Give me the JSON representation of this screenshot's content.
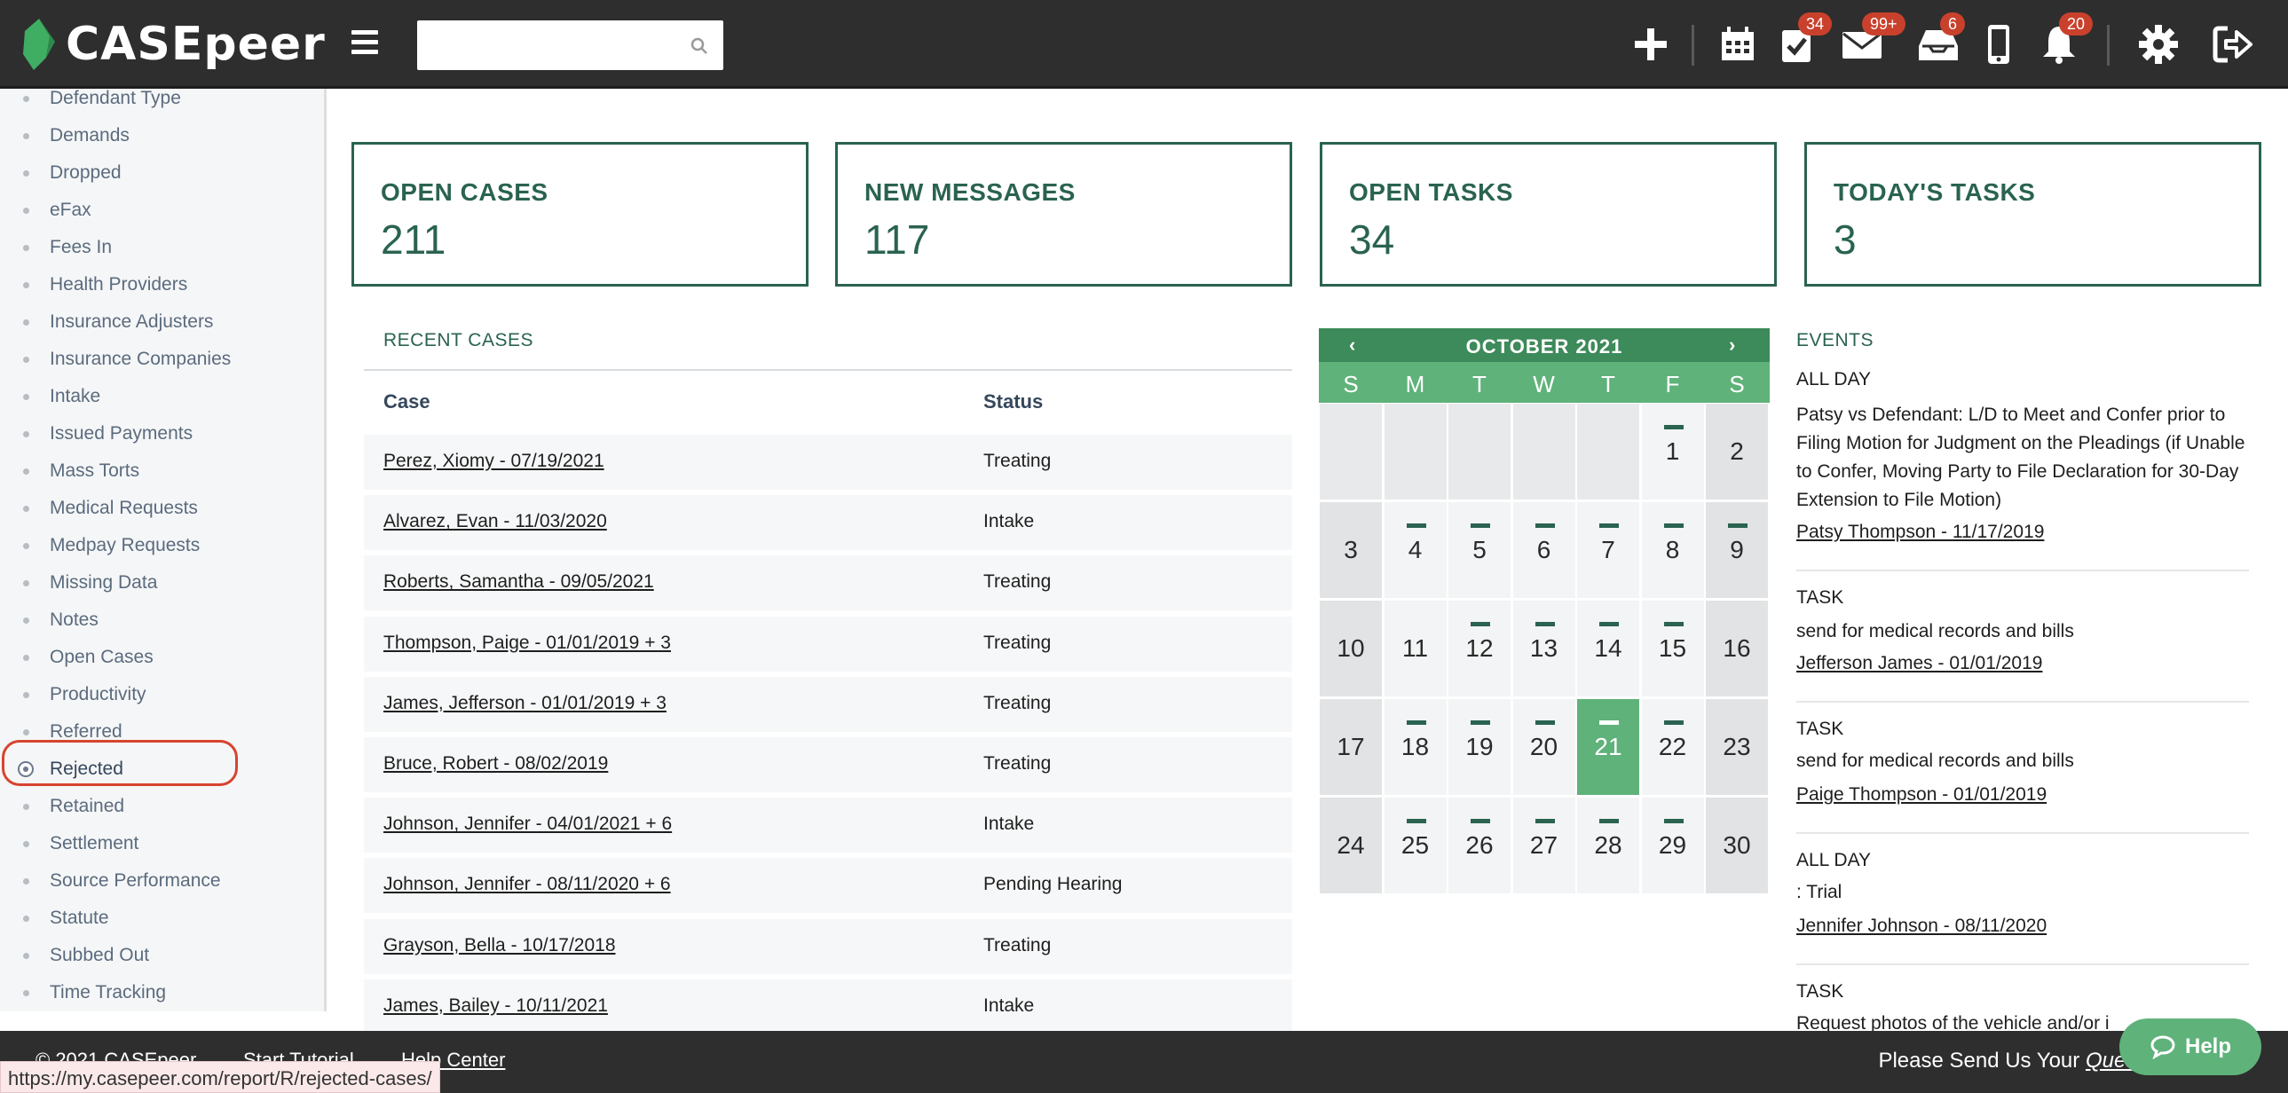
{
  "app": {
    "logo_text": "CASEpeer"
  },
  "search": {
    "placeholder": ""
  },
  "topbar": {
    "badges": {
      "tasks": "34",
      "messages": "99+",
      "inbox": "6",
      "notifications": "20"
    }
  },
  "sidebar": {
    "items": [
      "Defendant Type",
      "Demands",
      "Dropped",
      "eFax",
      "Fees In",
      "Health Providers",
      "Insurance Adjusters",
      "Insurance Companies",
      "Intake",
      "Issued Payments",
      "Mass Torts",
      "Medical Requests",
      "Medpay Requests",
      "Missing Data",
      "Notes",
      "Open Cases",
      "Productivity",
      "Referred",
      "Rejected",
      "Retained",
      "Settlement",
      "Source Performance",
      "Statute",
      "Subbed Out",
      "Time Tracking"
    ],
    "active": "Rejected"
  },
  "stats": [
    {
      "title": "OPEN CASES",
      "value": "211"
    },
    {
      "title": "NEW MESSAGES",
      "value": "117"
    },
    {
      "title": "OPEN TASKS",
      "value": "34"
    },
    {
      "title": "TODAY'S TASKS",
      "value": "3"
    }
  ],
  "recent_cases": {
    "title": "RECENT CASES",
    "col_case": "Case",
    "col_status": "Status",
    "rows": [
      {
        "case": "Perez, Xiomy - 07/19/2021",
        "status": "Treating"
      },
      {
        "case": "Alvarez, Evan - 11/03/2020",
        "status": "Intake"
      },
      {
        "case": "Roberts, Samantha - 09/05/2021",
        "status": "Treating"
      },
      {
        "case": "Thompson, Paige - 01/01/2019 + 3",
        "status": "Treating"
      },
      {
        "case": "James, Jefferson - 01/01/2019 + 3",
        "status": "Treating"
      },
      {
        "case": "Bruce, Robert - 08/02/2019",
        "status": "Treating"
      },
      {
        "case": "Johnson, Jennifer - 04/01/2021 + 6",
        "status": "Intake"
      },
      {
        "case": "Johnson, Jennifer - 08/11/2020 + 6",
        "status": "Pending Hearing"
      },
      {
        "case": "Grayson, Bella - 10/17/2018",
        "status": "Treating"
      },
      {
        "case": "James, Bailey - 10/11/2021",
        "status": "Intake"
      }
    ]
  },
  "calendar": {
    "prev": "‹",
    "next": "›",
    "month": "OCTOBER 2021",
    "dow": [
      "S",
      "M",
      "T",
      "W",
      "T",
      "F",
      "S"
    ],
    "first_weekday": 5,
    "days": 30,
    "today": 21,
    "event_days": [
      1,
      4,
      5,
      6,
      7,
      8,
      9,
      12,
      13,
      14,
      15,
      18,
      19,
      20,
      21,
      22,
      25,
      26,
      27,
      28,
      29
    ]
  },
  "events": {
    "title": "EVENTS",
    "items": [
      {
        "type": "ALL DAY",
        "desc": "Patsy vs Defendant: L/D to Meet and Confer prior to Filing Motion for Judgment on the Pleadings (if Unable to Confer, Moving Party to File Declaration for 30-Day Extension to File Motion)",
        "link": "Patsy Thompson - 11/17/2019"
      },
      {
        "type": "TASK",
        "desc": "send for medical records and bills",
        "link": "Jefferson James - 01/01/2019"
      },
      {
        "type": "TASK",
        "desc": "send for medical records and bills",
        "link": "Paige Thompson - 01/01/2019"
      },
      {
        "type": "ALL DAY",
        "desc": ": Trial",
        "link": "Jennifer Johnson - 08/11/2020"
      },
      {
        "type": "TASK",
        "desc": "Request photos of the vehicle and/or i",
        "link": ""
      }
    ]
  },
  "footer": {
    "copyright": "© 2021 CASEpeer",
    "tutorial": "Start Tutorial",
    "help_center": "Help Center",
    "message_prefix": "Please Send Us Your ",
    "message_link": "Questions"
  },
  "status_url": "https://my.casepeer.com/report/R/rejected-cases/",
  "help_button": "Help",
  "colors": {
    "brand_green": "#2a6350",
    "calendar_green": "#5fb27a",
    "header_dark": "#2e2e2e",
    "badge_red": "#c9412c",
    "highlight_red": "#d7442e"
  }
}
